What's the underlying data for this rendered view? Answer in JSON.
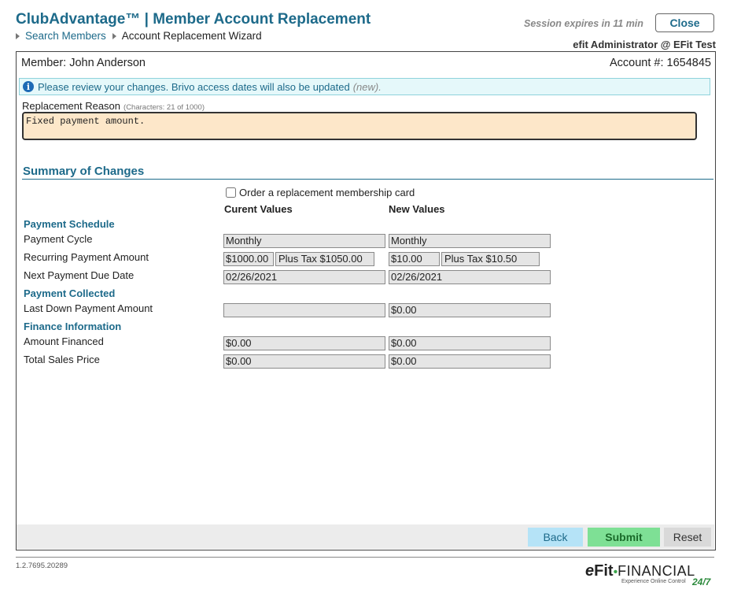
{
  "header": {
    "title": "ClubAdvantage™ | Member Account Replacement",
    "breadcrumb": {
      "link": "Search Members",
      "current": "Account Replacement Wizard"
    },
    "session": "Session expires in 11 min",
    "close_label": "Close",
    "user": "efit Administrator @ EFit Test"
  },
  "member": {
    "label": "Member: John Anderson",
    "account": "Account #: 1654845"
  },
  "info": {
    "message": "Please review your changes. Brivo access dates will also be updated",
    "new_tag": "(new)",
    "suffix": "."
  },
  "reason": {
    "label": "Replacement Reason",
    "counter": "(Characters: 21 of 1000)",
    "value": "Fixed payment amount."
  },
  "summary": {
    "title": "Summary of Changes",
    "order_card_label": "Order a replacement membership card",
    "col_current": "Curent Values",
    "col_new": "New Values",
    "sections": {
      "payment_schedule": "Payment Schedule",
      "payment_collected": "Payment Collected",
      "finance_information": "Finance Information"
    },
    "rows": {
      "payment_cycle": {
        "label": "Payment Cycle",
        "current": "Monthly",
        "new": "Monthly"
      },
      "recurring": {
        "label": "Recurring Payment Amount",
        "current": "$1000.00",
        "current_tax": "Plus Tax $1050.00",
        "new": "$10.00",
        "new_tax": "Plus Tax $10.50"
      },
      "next_due": {
        "label": "Next Payment Due Date",
        "current": "02/26/2021",
        "new": "02/26/2021"
      },
      "last_down": {
        "label": "Last Down Payment Amount",
        "current": "",
        "new": "$0.00"
      },
      "amount_financed": {
        "label": "Amount Financed",
        "current": "$0.00",
        "new": "$0.00"
      },
      "total_sales": {
        "label": "Total Sales Price",
        "current": "$0.00",
        "new": "$0.00"
      }
    }
  },
  "buttons": {
    "back": "Back",
    "submit": "Submit",
    "reset": "Reset"
  },
  "footer": {
    "version": "1.2.7695.20289",
    "logo_e": "e",
    "logo_fit": "Fit",
    "logo_dot": "•",
    "logo_financial": "FINANCIAL",
    "tagline": "Experience Online Control",
    "tag_247": "24/7"
  },
  "colors": {
    "accent": "#1d6a8a",
    "submit": "#7ee095",
    "back": "#b5e3f7",
    "reason_bg": "#fde7c9",
    "info_bg": "#e5f8fa"
  }
}
